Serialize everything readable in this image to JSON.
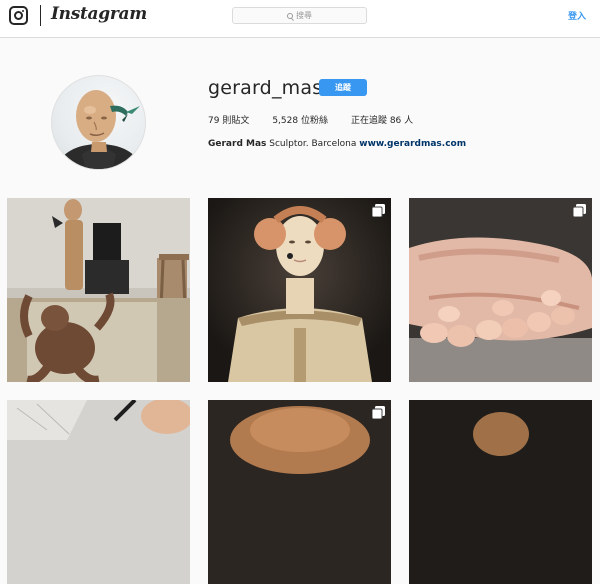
{
  "header": {
    "brand": "Instagram",
    "search_placeholder": "搜尋",
    "login_label": "登入",
    "accent_color": "#3897f0"
  },
  "profile": {
    "username": "gerard_mas",
    "follow_label": "追蹤",
    "stats": [
      {
        "key": "posts",
        "text": "79 則貼文"
      },
      {
        "key": "followers",
        "text": "5,528 位粉絲"
      },
      {
        "key": "following",
        "text": "正在追蹤 86 人"
      }
    ],
    "bio_name": "Gerard Mas",
    "bio_text": " Sculptor. Barcelona ",
    "bio_link": "www.gerardmas.com"
  },
  "posts": [
    {
      "id": "post-1",
      "multi": false
    },
    {
      "id": "post-2",
      "multi": true
    },
    {
      "id": "post-3",
      "multi": true
    },
    {
      "id": "post-4",
      "multi": false
    },
    {
      "id": "post-5",
      "multi": true
    },
    {
      "id": "post-6",
      "multi": false
    }
  ],
  "icons": {
    "logo": "instagram-camera-icon",
    "search": "search-icon",
    "multi": "carousel-icon"
  }
}
